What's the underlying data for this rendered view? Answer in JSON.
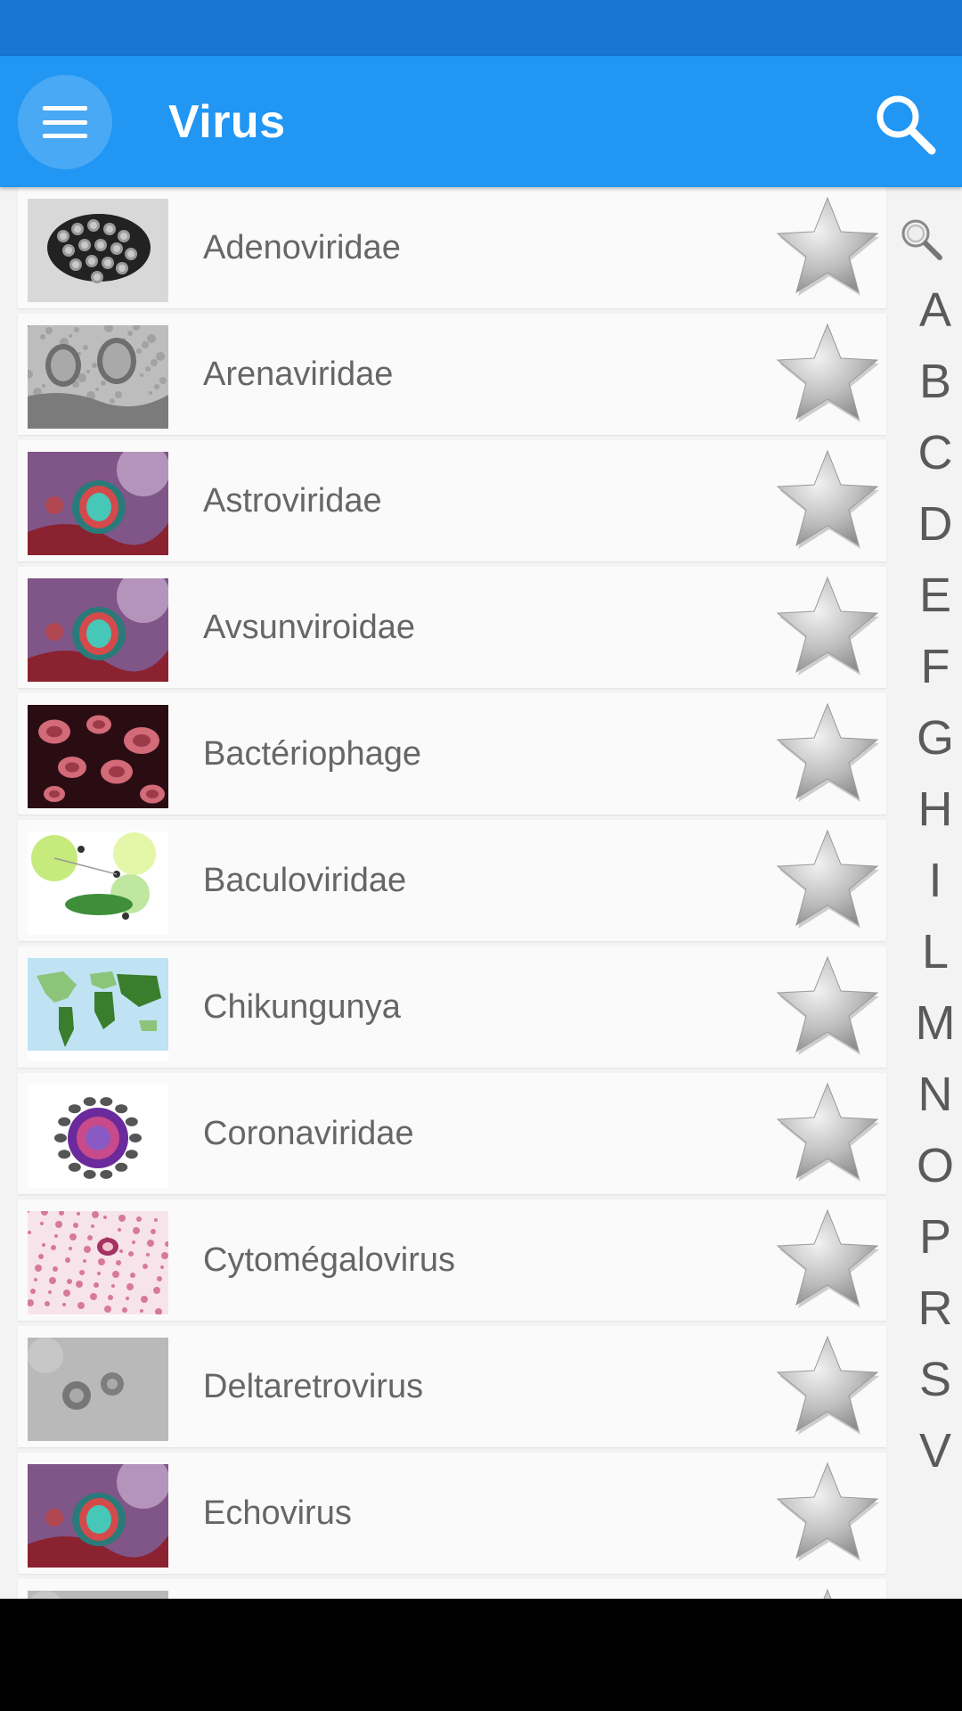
{
  "app_bar": {
    "title": "Virus",
    "menu_icon": "hamburger-menu-icon",
    "search_icon": "search-icon",
    "color": "#2196f3",
    "status_bar_color": "#1976d2"
  },
  "list": {
    "items": [
      {
        "label": "Adenoviridae",
        "thumb": "electron-micrograph-dark"
      },
      {
        "label": "Arenaviridae",
        "thumb": "electron-micrograph-gray"
      },
      {
        "label": "Astroviridae",
        "thumb": "illustration-purple"
      },
      {
        "label": "Avsunviroidae",
        "thumb": "illustration-purple"
      },
      {
        "label": "Bactériophage",
        "thumb": "red-cells"
      },
      {
        "label": "Baculoviridae",
        "thumb": "green-diagram"
      },
      {
        "label": "Chikungunya",
        "thumb": "world-map"
      },
      {
        "label": "Coronaviridae",
        "thumb": "virus-diagram"
      },
      {
        "label": "Cytomégalovirus",
        "thumb": "pink-histology"
      },
      {
        "label": "Deltaretrovirus",
        "thumb": "electron-micrograph-light"
      },
      {
        "label": "Echovirus",
        "thumb": "illustration-purple"
      }
    ],
    "favorite_icon": "star-icon"
  },
  "index": {
    "search_icon": "search-icon",
    "letters": [
      "A",
      "B",
      "C",
      "D",
      "E",
      "F",
      "G",
      "H",
      "I",
      "L",
      "M",
      "N",
      "O",
      "P",
      "R",
      "S",
      "V"
    ]
  }
}
